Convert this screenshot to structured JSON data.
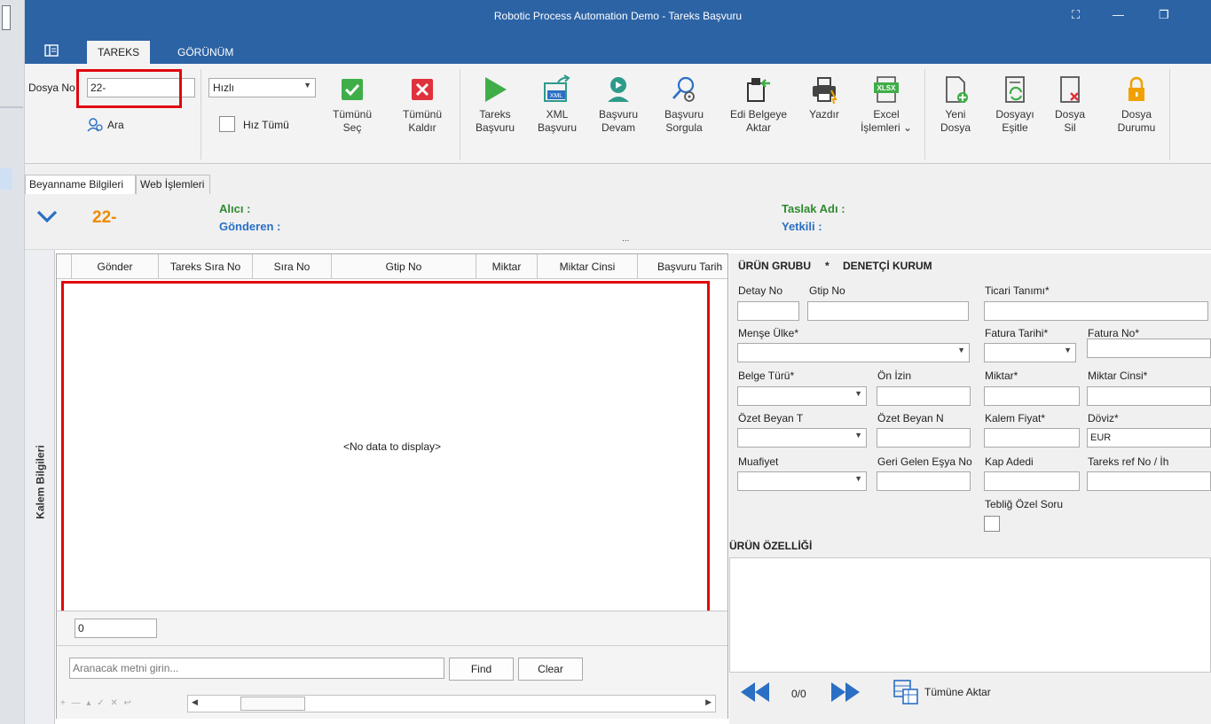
{
  "window": {
    "title": "Robotic Process Automation Demo - Tareks Başvuru",
    "btn_restore_small": "⛶",
    "btn_min": "—",
    "btn_max": "❐"
  },
  "ribbon_tabs": [
    "TAREKS",
    "GÖRÜNÜM"
  ],
  "file_box": {
    "label": "Dosya No",
    "value": "22-",
    "search_label": "Ara"
  },
  "speed": {
    "value": "Hızlı",
    "all_label": "Hız Tümü"
  },
  "ribbon_buttons": {
    "select_all": [
      "Tümünü",
      "Seç"
    ],
    "clear_all": [
      "Tümünü",
      "Kaldır"
    ],
    "tareks_apply": [
      "Tareks",
      "Başvuru"
    ],
    "xml_apply": [
      "XML",
      "Başvuru"
    ],
    "apply_continue": [
      "Başvuru",
      "Devam"
    ],
    "apply_query": [
      "Başvuru",
      "Sorgula"
    ],
    "edi_transfer": [
      "Edi Belgeye",
      "Aktar"
    ],
    "print": [
      "Yazdır",
      ""
    ],
    "excel": [
      "Excel",
      "İşlemleri ⌄"
    ],
    "new_file": [
      "Yeni",
      "Dosya"
    ],
    "sync_file": [
      "Dosyayı",
      "Eşitle"
    ],
    "delete_file": [
      "Dosya",
      "Sil"
    ],
    "file_status": [
      "Dosya",
      "Durumu"
    ]
  },
  "icon_texts": {
    "xml": "XML",
    "xlsx": "XLSX"
  },
  "page_tabs": [
    "Beyanname Bilgileri",
    "Web İşlemleri"
  ],
  "header": {
    "number": "22-",
    "alici": "Alıcı :",
    "gonderen": "Gönderen :",
    "taslak": "Taslak Adı :",
    "yetkili": "Yetkili :",
    "ellipsis": "..."
  },
  "side_label": "Kalem Bilgileri",
  "grid": {
    "columns": [
      "Gönder",
      "Tareks Sıra No",
      "Sıra No",
      "Gtip No",
      "Miktar",
      "Miktar Cinsi",
      "Başvuru Tarih"
    ],
    "empty_text": "<No data to display>",
    "count_value": "0",
    "search_placeholder": "Aranacak metni girin...",
    "find": "Find",
    "clear": "Clear",
    "nav_glyphs": "+ — ▴ ✓ ✕ ↩"
  },
  "detail": {
    "urun_grubu": "ÜRÜN GRUBU",
    "star": "*",
    "denetci": "DENETÇİ KURUM",
    "detay_no": "Detay No",
    "gtip_no": "Gtip No",
    "ticari": "Ticari Tanımı*",
    "mense": "Menşe Ülke*",
    "fatura_tarihi": "Fatura Tarihi*",
    "fatura_no": "Fatura No*",
    "belge_turu": "Belge Türü*",
    "on_izin": "Ön İzin",
    "miktar": "Miktar*",
    "miktar_cinsi": "Miktar Cinsi*",
    "ozet_t": "Özet Beyan T",
    "ozet_n": "Özet Beyan N",
    "kalem_fiyat": "Kalem Fiyat*",
    "doviz": "Döviz*",
    "doviz_value": "EUR",
    "muafiyet": "Muafiyet",
    "geri_gelen": "Geri Gelen Eşya No",
    "kap_adedi": "Kap Adedi",
    "tareks_ref": "Tareks ref No / İh",
    "teblig": "Tebliğ Özel Soru",
    "urun_ozelligi": "ÜRÜN ÖZELLİĞİ",
    "pager": "0/0",
    "transfer_all": "Tümüne Aktar"
  },
  "colors": {
    "title_blue": "#2c63a5",
    "ribbon_bg": "#f3f3f3",
    "highlight_red": "#e0070f",
    "number_orange": "#f08a00",
    "label_green": "#2f8a2f",
    "label_blue": "#2a6fc4",
    "icon_green": "#3fae49",
    "icon_red": "#e0323c",
    "icon_teal": "#2f9a8a",
    "icon_blue": "#2a6fc4",
    "icon_orange": "#f0a000"
  }
}
